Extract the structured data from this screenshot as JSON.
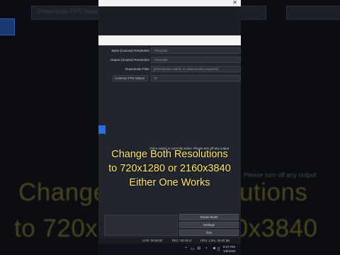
{
  "background": {
    "field_text": "Downscale FPS Values",
    "side_note": "Please turn off any output",
    "caption_line1": "Change Both Resolutions",
    "caption_line2": "to 720x1280 or 2160x3840"
  },
  "settings": {
    "base_resolution": {
      "label": "Base (Canvas) Resolution",
      "value": "720x1280"
    },
    "output_resolution": {
      "label": "Output (Scaled) Resolution",
      "value": "720x1280"
    },
    "downscale_filter": {
      "label": "Downscale Filter",
      "value": "[Resolutions match, no downscaling required]"
    },
    "fps": {
      "select": "Common FPS Values",
      "value": "30"
    },
    "warning": "Video output is currently active. Please turn off any output"
  },
  "caption": {
    "line1": "Change Both Resolutions",
    "line2": "to 720x1280 or 2160x3840",
    "line3": "Either One Works"
  },
  "controls": {
    "studio_mode": "Studio Mode",
    "settings": "Settings",
    "exit": "Exit"
  },
  "status": {
    "live": "LIVE: 00:00:00",
    "rec": "REC: 00:00:17",
    "cpu": "CPU: 1.8%, 30.00 fps"
  },
  "taskbar": {
    "time": "9:47 PM",
    "date": "1/8/2022"
  },
  "colors": {
    "caption": "#ffe76e",
    "accent": "#2f6cd9"
  }
}
